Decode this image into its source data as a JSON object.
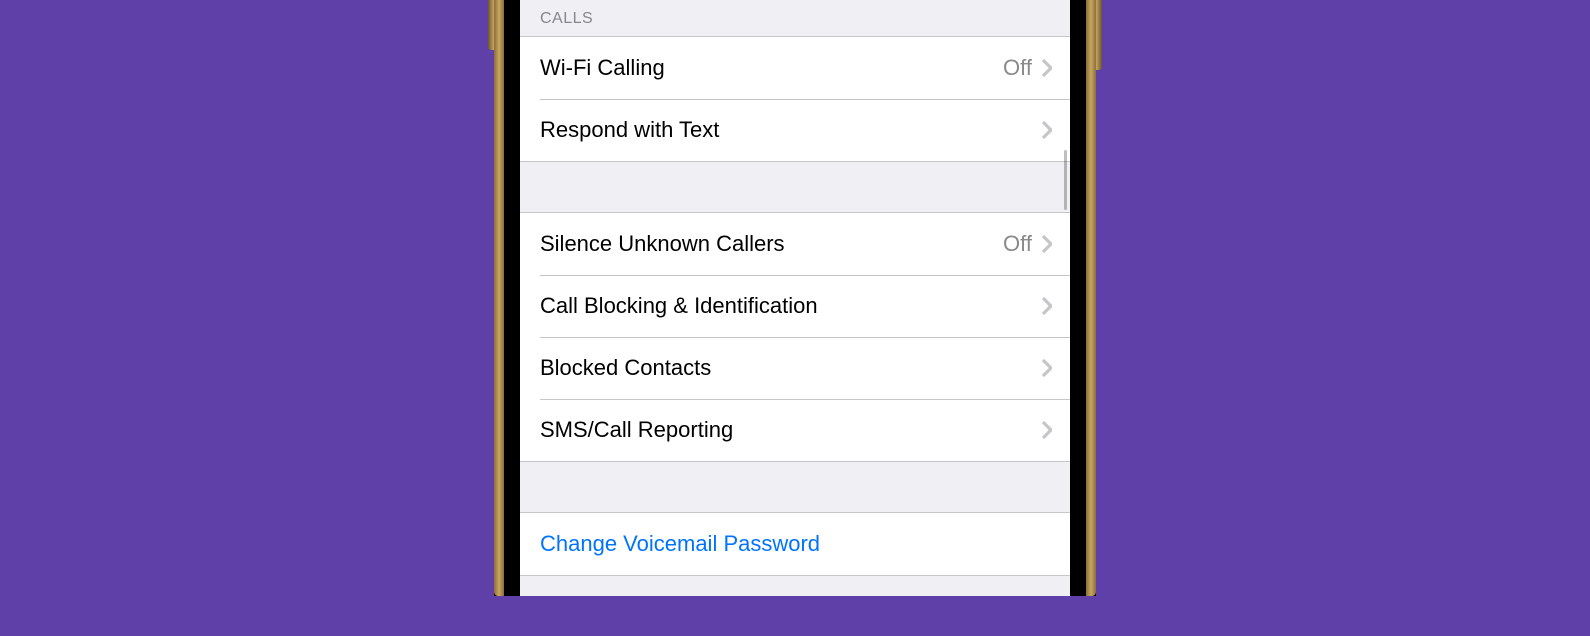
{
  "sections": {
    "calls": {
      "header": "Calls",
      "items": [
        {
          "label": "Wi-Fi Calling",
          "value": "Off"
        },
        {
          "label": "Respond with Text",
          "value": ""
        }
      ]
    },
    "blocking": {
      "items": [
        {
          "label": "Silence Unknown Callers",
          "value": "Off"
        },
        {
          "label": "Call Blocking & Identification",
          "value": ""
        },
        {
          "label": "Blocked Contacts",
          "value": ""
        },
        {
          "label": "SMS/Call Reporting",
          "value": ""
        }
      ]
    },
    "voicemail": {
      "items": [
        {
          "label": "Change Voicemail Password"
        }
      ]
    }
  }
}
